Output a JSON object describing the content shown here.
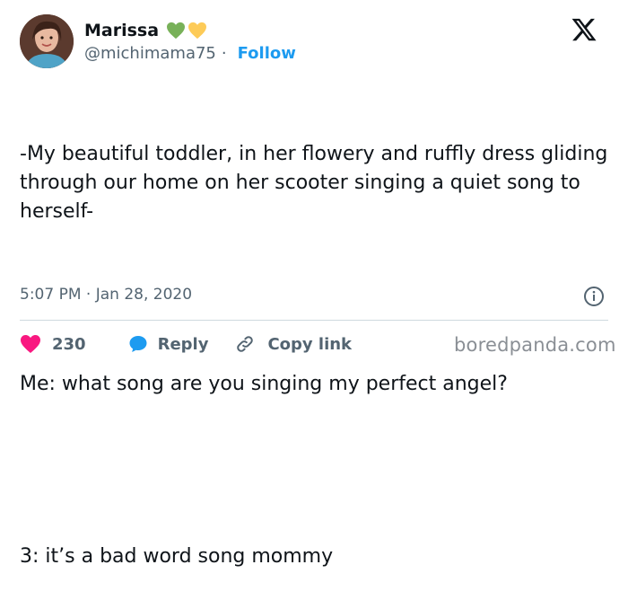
{
  "author": {
    "display_name": "Marissa",
    "handle": "@michimama75",
    "follow_label": "Follow",
    "name_emoji": [
      "green-heart",
      "yellow-heart"
    ]
  },
  "tweet": {
    "paragraphs": [
      "-My beautiful toddler, in her flowery and ruffly dress gliding through our home on her scooter singing a quiet song to herself-",
      "Me: what song are you singing my perfect angel?",
      "3: it’s a bad word song mommy"
    ],
    "timestamp": "5:07 PM · Jan 28, 2020"
  },
  "actions": {
    "like_count": "230",
    "reply_label": "Reply",
    "copy_label": "Copy link"
  },
  "watermark": "boredpanda.com",
  "colors": {
    "accent": "#1d9bf0",
    "like": "#f91880",
    "text": "#0f1419",
    "muted": "#536471",
    "green_heart": "#78b159",
    "yellow_heart": "#fdcb58"
  }
}
